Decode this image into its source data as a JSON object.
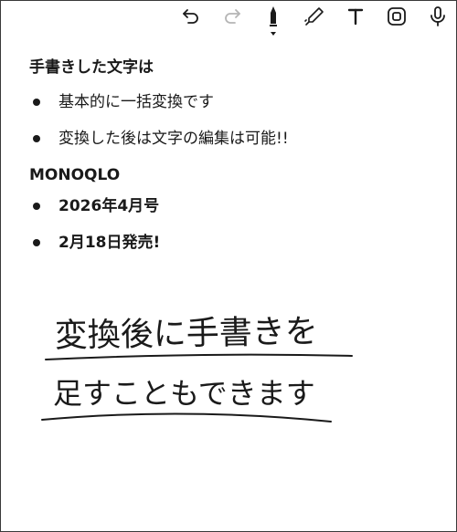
{
  "toolbar": {
    "icons": [
      "undo-icon",
      "redo-icon",
      "pen-icon",
      "pencil-icon",
      "text-icon",
      "lasso-icon",
      "microphone-icon"
    ]
  },
  "note": {
    "section1": {
      "heading": "手書きした文字は",
      "items": [
        "基本的に一括変換です",
        "変換した後は文字の編集は可能!!"
      ]
    },
    "section2": {
      "heading": "MONOQLO",
      "items": [
        "2026年4月号",
        "2月18日発売!"
      ]
    },
    "handwriting": {
      "line1": "変換後に手書きを",
      "line2": "足すこともできます"
    }
  }
}
